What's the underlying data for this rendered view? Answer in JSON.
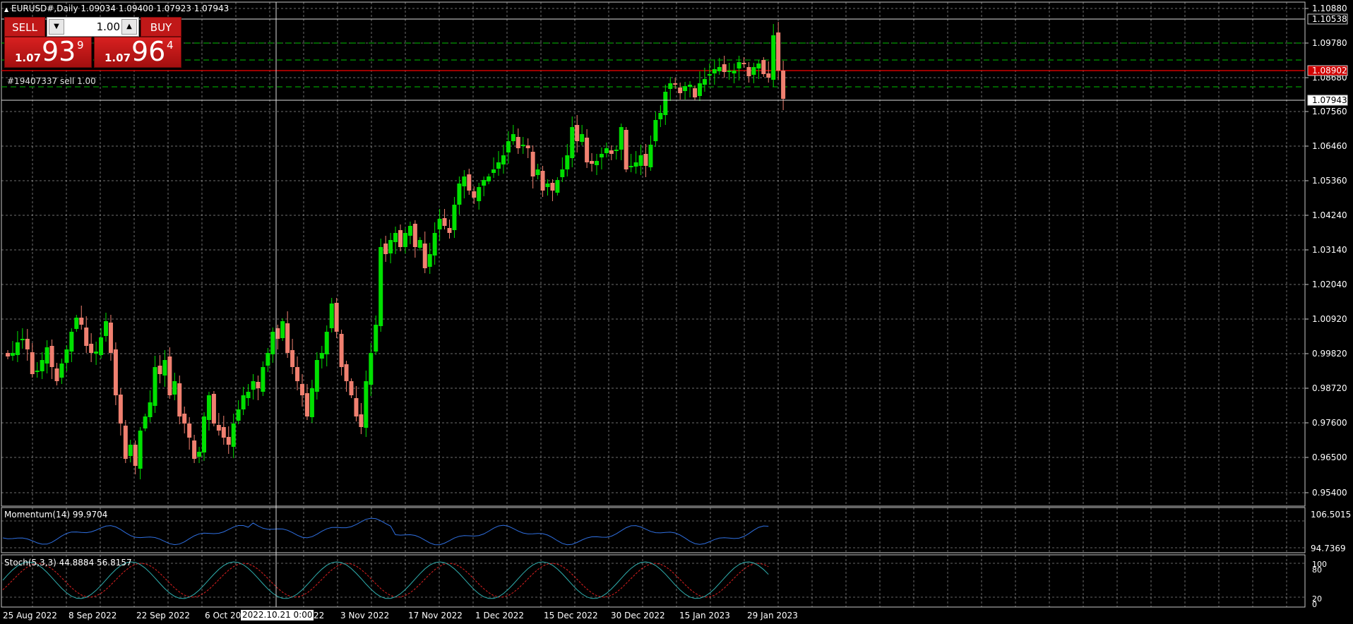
{
  "chart": {
    "title": "EURUSD#,Daily  1.09034 1.09400 1.07923 1.07943",
    "order_label": "#19407337 sell 1.00",
    "price_levels": [
      "1.10880",
      "1.09780",
      "1.08680",
      "1.07560",
      "1.06460",
      "1.05360",
      "1.04240",
      "1.03140",
      "1.02040",
      "1.00920",
      "0.99820",
      "0.98720",
      "0.97600",
      "0.96500",
      "0.95400"
    ],
    "marker_high": "1.10538",
    "marker_bid": "1.08902",
    "marker_last": "1.07943",
    "date_labels": [
      "25 Aug 2022",
      "8 Sep 2022",
      "22 Sep 2022",
      "6 Oct 20",
      "22",
      "3 Nov 2022",
      "17 Nov 2022",
      "1 Dec 2022",
      "15 Dec 2022",
      "30 Dec 2022",
      "15 Jan 2023",
      "29 Jan 2023"
    ],
    "crosshair_date": "2022.10.21 0:00",
    "colors": {
      "up": "#00e000",
      "down": "#f08070",
      "grid": "#c8c8c8",
      "bid": "#d00000",
      "momentum": "#2f6fe0",
      "stoch_main": "#30b0b0",
      "stoch_signal": "#e02020"
    }
  },
  "trade_panel": {
    "sell_label": "SELL",
    "buy_label": "BUY",
    "lot_value": "1.00",
    "down_icon": "arrow-down-icon",
    "up_icon": "arrow-up-icon",
    "sell_small": "1.07",
    "sell_big": "93",
    "sell_sup": "9",
    "buy_small": "1.07",
    "buy_big": "96",
    "buy_sup": "4"
  },
  "momentum": {
    "label": "Momentum(14) 99.9704",
    "levels": [
      "106.5015",
      "94.7369"
    ]
  },
  "stoch": {
    "label": "Stoch(5,3,3) 44.8884 56.8157",
    "levels": [
      "100",
      "80",
      "20",
      "0"
    ]
  }
}
